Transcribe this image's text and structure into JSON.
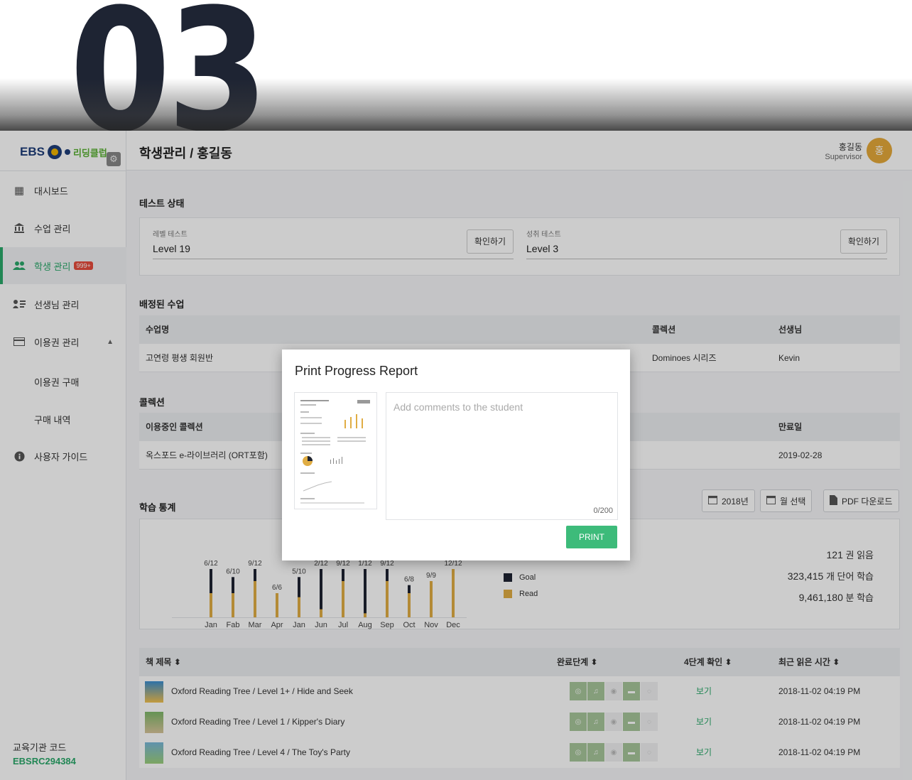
{
  "hero_number": "03",
  "app": {
    "logo": {
      "ebs": "EBS",
      "reading_club": "리딩클럽"
    },
    "gear_icon": "⚙",
    "nav": [
      {
        "label": "대시보드",
        "icon": "dashboard-icon",
        "glyph": "▦"
      },
      {
        "label": "수업 관리",
        "icon": "bank-icon",
        "glyph": "🏛"
      },
      {
        "label": "학생 관리",
        "icon": "people-icon",
        "glyph": "👥",
        "badge": "999+"
      },
      {
        "label": "선생님 관리",
        "icon": "teacher-list-icon",
        "glyph": "☰"
      },
      {
        "label": "이용권 관리",
        "icon": "card-icon",
        "glyph": "▭"
      },
      {
        "label": "이용권 구매"
      },
      {
        "label": "구매 내역"
      },
      {
        "label": "사용자 가이드",
        "icon": "info-icon",
        "glyph": "ⓘ"
      }
    ],
    "org_label": "교육기관 코드",
    "org_code": "EBSRC294384",
    "page_title": "학생관리 / 홍길동",
    "user": {
      "name": "홍길동",
      "role": "Supervisor",
      "avatar": "홍"
    }
  },
  "test_status": {
    "title": "테스트 상태",
    "level": {
      "label": "레벨 테스트",
      "value": "Level 19",
      "button": "확인하기"
    },
    "achievement": {
      "label": "성취 테스트",
      "value": "Level 3",
      "button": "확인하기"
    }
  },
  "assigned_classes": {
    "title": "배정된 수업",
    "headers": [
      "수업명",
      "콜렉션",
      "선생님"
    ],
    "rows": [
      [
        "고연령 평생 회원반",
        "Dominoes 시리즈",
        "Kevin"
      ]
    ]
  },
  "collections": {
    "title": "콜렉션",
    "headers": [
      "이용중인 콜렉션",
      "만료일"
    ],
    "rows": [
      [
        "옥스포드 e-라이브러리 (ORT포함)",
        "2019-02-28"
      ]
    ]
  },
  "study_stats": {
    "title": "학습 통계",
    "year_button": "2018년",
    "month_button": "월 선택",
    "pdf_button": "PDF 다운로드",
    "stats": [
      {
        "value": "121",
        "unit": "권 읽음"
      },
      {
        "value": "323,415",
        "unit": "개 단어 학습"
      },
      {
        "value": "9,461,180",
        "unit": "분 학습"
      }
    ],
    "legend": {
      "goal": "Goal",
      "read": "Read"
    },
    "colors": {
      "goal": "#1e2433",
      "read": "#e0ad44"
    }
  },
  "chart_data": {
    "type": "bar",
    "categories": [
      "Jan",
      "Fab",
      "Mar",
      "Apr",
      "Jan",
      "Jun",
      "Jul",
      "Aug",
      "Sep",
      "Oct",
      "Nov",
      "Dec"
    ],
    "series": [
      {
        "name": "Goal",
        "values": [
          12,
          10,
          12,
          6,
          10,
          12,
          12,
          12,
          12,
          8,
          9,
          12
        ]
      },
      {
        "name": "Read",
        "values": [
          6,
          6,
          9,
          6,
          5,
          2,
          9,
          1,
          9,
          6,
          9,
          12
        ]
      }
    ],
    "data_labels": [
      "6/12",
      "6/10",
      "9/12",
      "6/6",
      "5/10",
      "2/12",
      "9/12",
      "1/12",
      "9/12",
      "6/8",
      "9/9",
      "12/12"
    ]
  },
  "books": {
    "headers": [
      "책 제목",
      "완료단계",
      "4단계 확인",
      "최근 읽은 시간"
    ],
    "rows": [
      {
        "title": "Oxford Reading Tree / Level 1+ / Hide and Seek",
        "link": "보기",
        "time": "2018-11-02 04:19 PM"
      },
      {
        "title": "Oxford Reading Tree / Level 1 / Kipper's Diary",
        "link": "보기",
        "time": "2018-11-02 04:19 PM"
      },
      {
        "title": "Oxford Reading Tree / Level 4 / The Toy's Party",
        "link": "보기",
        "time": "2018-11-02 04:19 PM"
      }
    ]
  },
  "modal": {
    "title": "Print Progress Report",
    "placeholder": "Add comments to the student",
    "counter": "0/200",
    "print_button": "PRINT"
  }
}
